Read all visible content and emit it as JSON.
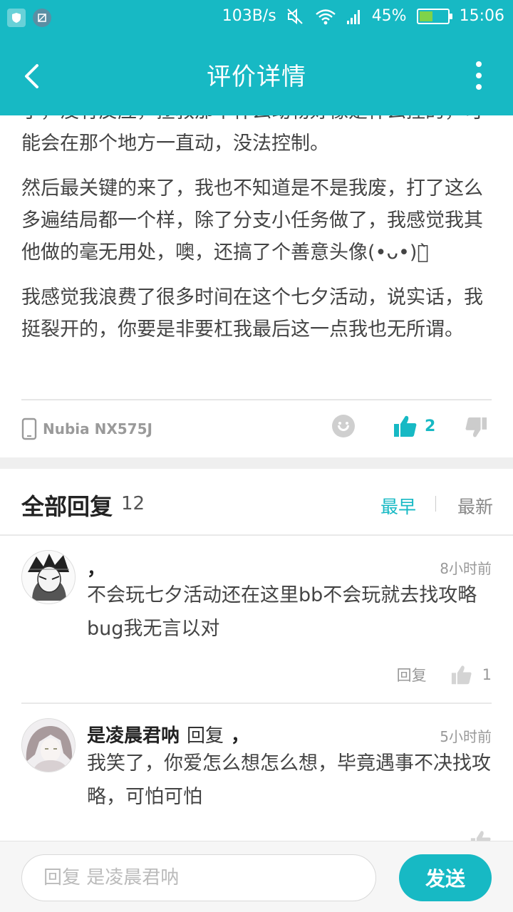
{
  "status_bar": {
    "net_speed": "103B/s",
    "battery_percent": "45%",
    "battery_level": 0.45,
    "time": "15:06"
  },
  "header": {
    "title": "评价详情"
  },
  "review": {
    "paragraphs": [
      "了，没有反应，拯救那个什么动物好像是什么控的，可能会在那个地方一直动，没法控制。",
      "然后最关键的来了，我也不知道是不是我废，打了这么多遍结局都一个样，除了分支小任务做了，我感觉我其他做的毫无用处，噢，还搞了个善意头像(•ᴗ•)ง̀",
      "我感觉我浪费了很多时间在这个七夕活动，说实话，我挺裂开的，你要是非要杠我最后这一点我也无所谓。"
    ],
    "device": "Nubia NX575J",
    "like_count": "2"
  },
  "replies_header": {
    "title": "全部回复",
    "count": "12",
    "sort_earliest": "最早",
    "sort_newest": "最新"
  },
  "replies": [
    {
      "name": "，",
      "time": "8小时前",
      "text": "不会玩七夕活动还在这里bb不会玩就去找攻略bug我无言以对",
      "reply_label": "回复",
      "likes": "1"
    },
    {
      "name": "是凌晨君呐",
      "reply_word": "回复",
      "reply_to": "，",
      "time": "5小时前",
      "text": "我笑了，你爱怎么想怎么想，毕竟遇事不决找攻略，可怕可怕"
    }
  ],
  "bottom_bar": {
    "input_placeholder": "回复 是凌晨君呐",
    "send_label": "发送"
  },
  "colors": {
    "accent": "#17b9c4",
    "battery_fill": "#7fd34a"
  }
}
